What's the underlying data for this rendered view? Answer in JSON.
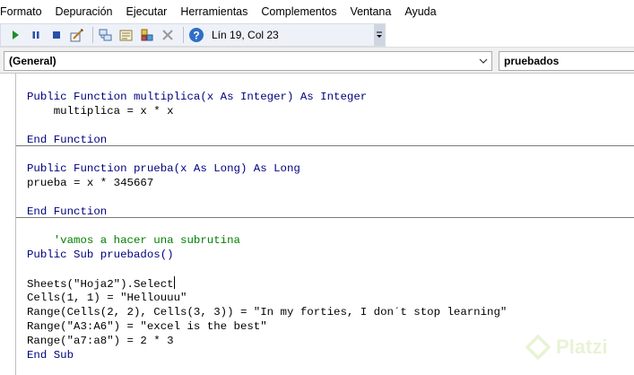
{
  "menu": [
    "Formato",
    "Depuración",
    "Ejecutar",
    "Herramientas",
    "Complementos",
    "Ventana",
    "Ayuda"
  ],
  "toolbar": {
    "status": "Lín 19, Col 23",
    "icons": [
      "run-icon",
      "pause-icon",
      "stop-icon",
      "design-mode-icon",
      "project-explorer-icon",
      "properties-icon",
      "object-browser-icon",
      "toolbox-icon",
      "help-icon"
    ]
  },
  "object_combo": {
    "value": "(General)"
  },
  "procedure_combo": {
    "value": "pruebados"
  },
  "code": {
    "line1": "Public Function multiplica(x As Integer) As Integer",
    "line2": "    multiplica = x * x",
    "line3": "End Function",
    "line4": "Public Function prueba(x As Long) As Long",
    "line5": "prueba = x * 345667",
    "line6": "End Function",
    "line7": "    'vamos a hacer una subrutina",
    "line8": "Public Sub pruebados()",
    "line9": "Sheets(\"Hoja2\").Select",
    "line10": "Cells(1, 1) = \"Hellouuu\"",
    "line11": "Range(Cells(2, 2), Cells(3, 3)) = \"In my forties, I don´t stop learning\"",
    "line12": "Range(\"A3:A6\") = \"excel is the best\"",
    "line13": "Range(\"a7:a8\") = 2 * 3",
    "line14": "End Sub"
  },
  "watermark": "Platzi",
  "colors": {
    "keyword": "#00007f",
    "comment": "#007f00",
    "watermark": "#98ca3f"
  }
}
